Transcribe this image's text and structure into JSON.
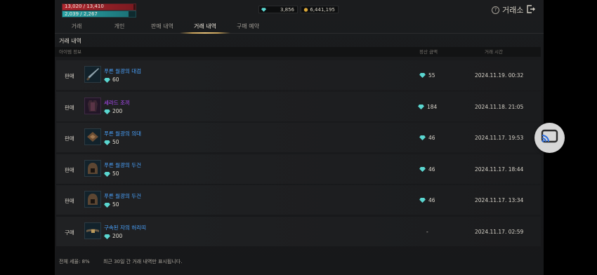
{
  "status": {
    "hp_text": "13,020 / 13,410",
    "hp_fraction": 0.971,
    "mp_text": "2,039 / 2,267",
    "mp_fraction": 0.9,
    "gems": "3,856",
    "gold": "6,441,195"
  },
  "header": {
    "title": "거래소",
    "help_icon": "help-circle-icon",
    "exit_icon": "exit-icon"
  },
  "tabs": [
    {
      "label": "거래",
      "active": false
    },
    {
      "label": "개인",
      "active": false
    },
    {
      "label": "판매 내역",
      "active": false
    },
    {
      "label": "거래 내역",
      "active": true
    },
    {
      "label": "구매 예약",
      "active": false
    }
  ],
  "section_title": "거래 내역",
  "columns": {
    "item_info": "아이템 정보",
    "settlement": "정산 금액",
    "time": "거래 시간"
  },
  "rows": [
    {
      "type": "판매",
      "name": "푸른 월광의 대검",
      "name_color": "#4aa3ff",
      "price": "60",
      "amount": "55",
      "time": "2024.11.19. 00:32",
      "icon": "greatsword-icon"
    },
    {
      "type": "판매",
      "name": "세라드 조끼",
      "name_color": "#b34cff",
      "price": "200",
      "amount": "184",
      "time": "2024.11.18. 21:05",
      "icon": "vest-icon"
    },
    {
      "type": "판매",
      "name": "푸른 월광의 의대",
      "name_color": "#4aa3ff",
      "price": "50",
      "amount": "46",
      "time": "2024.11.17. 19:53",
      "icon": "belt-armor-icon"
    },
    {
      "type": "판매",
      "name": "푸른 월광의 두건",
      "name_color": "#4aa3ff",
      "price": "50",
      "amount": "46",
      "time": "2024.11.17. 18:44",
      "icon": "hood-icon"
    },
    {
      "type": "판매",
      "name": "푸른 월광의 두건",
      "name_color": "#4aa3ff",
      "price": "50",
      "amount": "46",
      "time": "2024.11.17. 13:34",
      "icon": "hood-icon"
    },
    {
      "type": "구매",
      "name": "구속된 자의 허리띠",
      "name_color": "#4aa3ff",
      "price": "200",
      "amount": "-",
      "time": "2024.11.17. 02:59",
      "icon": "waist-belt-icon"
    }
  ],
  "footer": {
    "tax": "전체 세율: 8%",
    "note": "최근 30일 간 거래 내역만 표시됩니다."
  },
  "overlay": {
    "icon": "screen-cast-icon"
  }
}
